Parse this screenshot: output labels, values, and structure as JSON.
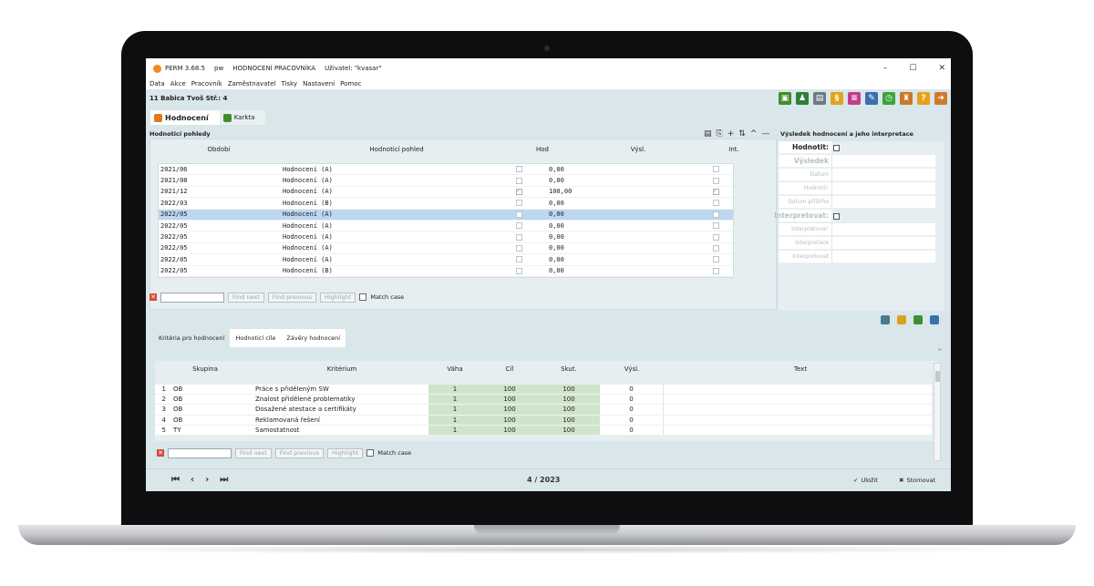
{
  "window": {
    "title_parts": [
      "PERM 3.68.5",
      "pw",
      "HODNOCENÍ PRACOVNÍKA",
      "Uživatel: \"kvasar\""
    ],
    "controls": [
      "–",
      "☐",
      "✕"
    ]
  },
  "menu": [
    "Data",
    "Akce",
    "Pracovník",
    "Zaměstnavatel",
    "Tisky",
    "Nastavení",
    "Pomoc"
  ],
  "toolbar": {
    "person": "11 Babica Tvoš Stř.: 4",
    "icons": [
      {
        "name": "id-card-icon",
        "color": "#3f8f2e",
        "glyph": "▣"
      },
      {
        "name": "people-icon",
        "color": "#2f7d3a",
        "glyph": "♟"
      },
      {
        "name": "document-icon",
        "color": "#6b7a80",
        "glyph": "▤"
      },
      {
        "name": "paragraph-icon",
        "color": "#e2a51a",
        "glyph": "§"
      },
      {
        "name": "form-icon",
        "color": "#c23d8c",
        "glyph": "≡"
      },
      {
        "name": "edit-icon",
        "color": "#3c6fb0",
        "glyph": "✎"
      },
      {
        "name": "clock-icon",
        "color": "#3ea33a",
        "glyph": "◷"
      },
      {
        "name": "bag-icon",
        "color": "#c8782a",
        "glyph": "♜"
      },
      {
        "name": "help-icon",
        "color": "#e8a21a",
        "glyph": "?"
      },
      {
        "name": "exit-icon",
        "color": "#d07a2c",
        "glyph": "➜"
      }
    ]
  },
  "top_tabs": [
    {
      "label": "Hodnocení",
      "active": true
    },
    {
      "label": "Karkta",
      "active": false
    }
  ],
  "views": {
    "title": "Hodnoticí pohledy",
    "columns": [
      "Období",
      "Hodnoticí pohled",
      "Hod",
      "Výsl.",
      "Int."
    ],
    "rows": [
      {
        "period": "2021/06",
        "view": "Hodnocení (A)",
        "hod": false,
        "vysl": "0,00",
        "int": false,
        "selected": false
      },
      {
        "period": "2021/08",
        "view": "Hodnocení (A)",
        "hod": false,
        "vysl": "0,00",
        "int": false,
        "selected": false
      },
      {
        "period": "2021/12",
        "view": "Hodnocení (A)",
        "hod": true,
        "vysl": "100,00",
        "int": true,
        "selected": false
      },
      {
        "period": "2022/03",
        "view": "Hodnocení (B)",
        "hod": false,
        "vysl": "0,00",
        "int": false,
        "selected": false
      },
      {
        "period": "2022/05",
        "view": "Hodnocení (A)",
        "hod": false,
        "vysl": "0,00",
        "int": false,
        "selected": true
      },
      {
        "period": "2022/05",
        "view": "Hodnocení (A)",
        "hod": false,
        "vysl": "0,00",
        "int": false,
        "selected": false
      },
      {
        "period": "2022/05",
        "view": "Hodnocení (A)",
        "hod": false,
        "vysl": "0,00",
        "int": false,
        "selected": false
      },
      {
        "period": "2022/05",
        "view": "Hodnocení (A)",
        "hod": false,
        "vysl": "0,00",
        "int": false,
        "selected": false
      },
      {
        "period": "2022/05",
        "view": "Hodnocení (A)",
        "hod": false,
        "vysl": "0,00",
        "int": false,
        "selected": false
      },
      {
        "period": "2022/05",
        "view": "Hodnocení (B)",
        "hod": false,
        "vysl": "0,00",
        "int": false,
        "selected": false
      }
    ],
    "tools": [
      "▤",
      "⎘",
      "+",
      "⇅",
      "^",
      "—"
    ]
  },
  "find": {
    "find_next": "Find next",
    "find_previous": "Find previous",
    "highlight": "Highlight",
    "match_case": "Match case"
  },
  "result_panel": {
    "title": "Výsledek hodnocení a jeho interpretace",
    "fields": [
      {
        "label": "Hodnotit:",
        "bold": true,
        "dark": true,
        "checkbox": true
      },
      {
        "label": "Výsledek",
        "bold": true,
        "dark": false,
        "checkbox": false
      },
      {
        "label": "Datum",
        "bold": false,
        "dark": false,
        "checkbox": false
      },
      {
        "label": "Hodnotil:",
        "bold": false,
        "dark": false,
        "checkbox": false
      },
      {
        "label": "Datum příštího",
        "bold": false,
        "dark": false,
        "checkbox": false
      },
      {
        "label": "Interpretovat:",
        "bold": true,
        "dark": false,
        "checkbox": true
      },
      {
        "label": "Interpretoval:",
        "bold": false,
        "dark": false,
        "checkbox": false
      },
      {
        "label": "Interpretace",
        "bold": false,
        "dark": false,
        "checkbox": false
      },
      {
        "label": "Interpretovat",
        "bold": false,
        "dark": false,
        "checkbox": false
      }
    ]
  },
  "bottom_tabs": [
    {
      "label": "Kritéria pro hodnocení",
      "active": false
    },
    {
      "label": "Hodnoticí cíle",
      "active": true
    },
    {
      "label": "Závěry hodnocení",
      "active": true
    }
  ],
  "criteria": {
    "columns": [
      "Skupina",
      "Kritérium",
      "Váha",
      "Cíl",
      "Skut.",
      "Výsl.",
      "Text"
    ],
    "rows": [
      {
        "n": "1",
        "group": "OB",
        "name": "Práce s přiděleným SW",
        "weight": "1",
        "goal": "100",
        "actual": "100",
        "result": "0"
      },
      {
        "n": "2",
        "group": "OB",
        "name": "Znalost přidělené problematiky",
        "weight": "1",
        "goal": "100",
        "actual": "100",
        "result": "0"
      },
      {
        "n": "3",
        "group": "OB",
        "name": "Dosažené atestace a certifikáty",
        "weight": "1",
        "goal": "100",
        "actual": "100",
        "result": "0"
      },
      {
        "n": "4",
        "group": "OB",
        "name": "Reklamovaná řešení",
        "weight": "1",
        "goal": "100",
        "actual": "100",
        "result": "0"
      },
      {
        "n": "5",
        "group": "TY",
        "name": "Samostatnost",
        "weight": "1",
        "goal": "100",
        "actual": "100",
        "result": "0"
      }
    ]
  },
  "status": {
    "nav": [
      "⏮",
      "‹",
      "›",
      "⏭"
    ],
    "period": "4 / 2023",
    "save": "Uložit",
    "cancel": "Stornovat"
  }
}
